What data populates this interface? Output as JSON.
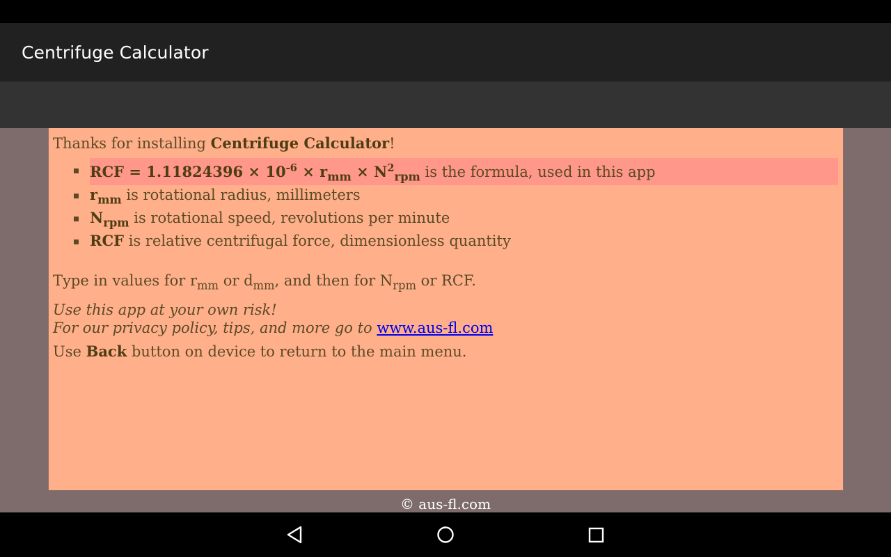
{
  "app_bar": {
    "title": "Centrifuge Calculator"
  },
  "info": {
    "intro_prefix": "Thanks for installing ",
    "intro_app_name": "Centrifuge Calculator",
    "intro_suffix": "!",
    "bullets": [
      {
        "formula_rcf": "RCF = 1.11824396 × 10",
        "formula_exp": "-6",
        "formula_times1": " × r",
        "formula_mm": "mm",
        "formula_times2": " × N",
        "formula_sq": "2",
        "formula_rpm": "rpm",
        "rest": " is the formula, used in this app"
      },
      {
        "term": "r",
        "term_sub": "mm",
        "rest": " is rotational radius, millimeters"
      },
      {
        "term": "N",
        "term_sub": "rpm",
        "rest": " is rotational speed, revolutions per minute"
      },
      {
        "term": "RCF",
        "rest": " is relative centrifugal force, dimensionless quantity"
      }
    ],
    "type_in": {
      "t1": "Type in values for r",
      "s1": "mm",
      "t2": " or d",
      "s2": "mm",
      "t3": ", and then for N",
      "s3": "rpm",
      "t4": " or RCF."
    },
    "risk": "Use this app at your own risk!",
    "privacy_prefix": "For our privacy policy, tips, and more go to ",
    "privacy_link": "www.aus-fl.com",
    "back_prefix": "Use ",
    "back_bold": "Back",
    "back_suffix": " button on device to return to the main menu."
  },
  "footer": {
    "copyright": "© aus-fl.com"
  },
  "nav": {
    "back_icon": "back-triangle-icon",
    "home_icon": "home-circle-icon",
    "recents_icon": "recents-square-icon"
  },
  "colors": {
    "app_bar": "#212121",
    "toolbar": "#333333",
    "content_bg": "#7e6c6c",
    "panel_bg": "#ffb08a",
    "highlight": "#ff978a",
    "text": "#5a4a26",
    "link": "#0000ee"
  }
}
